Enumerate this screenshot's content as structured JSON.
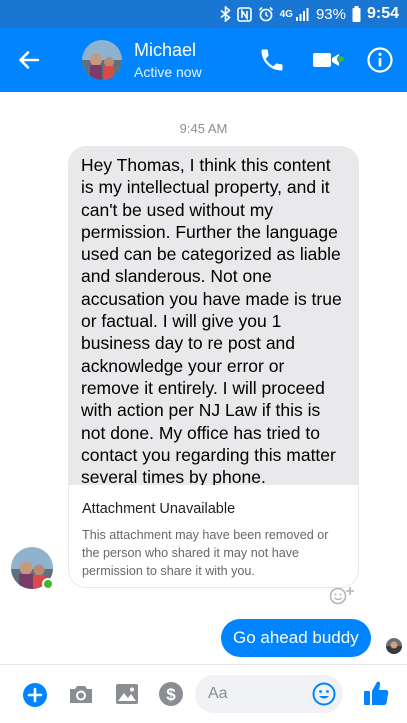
{
  "status_bar": {
    "network_label": "4G",
    "battery_percent": "93%",
    "time": "9:54"
  },
  "header": {
    "contact_name": "Michael",
    "contact_status": "Active now"
  },
  "conversation": {
    "timestamp": "9:45 AM",
    "received_message": "Hey Thomas, I think this content is my intellectual property, and it can't be used without my permission. Further the language used can be categorized as liable and slanderous.  Not one accusation you have made is true or factual.  I will give you 1 business day to re post and acknowledge your error or remove it entirely. I will proceed with action per NJ Law if this is not done. My office has tried to contact you regarding this matter several times by phone.",
    "attachment": {
      "title": "Attachment Unavailable",
      "description": "This attachment may have been removed or the person who shared it may not have permission to share it with you."
    },
    "sent_message": "Go ahead buddy"
  },
  "composer": {
    "placeholder": "Aa"
  },
  "colors": {
    "status_bar": "#1976d2",
    "header": "#0084ff",
    "outgoing_bubble": "#0084ff",
    "incoming_bubble": "#e9e9eb",
    "online_indicator": "#42b72a"
  }
}
